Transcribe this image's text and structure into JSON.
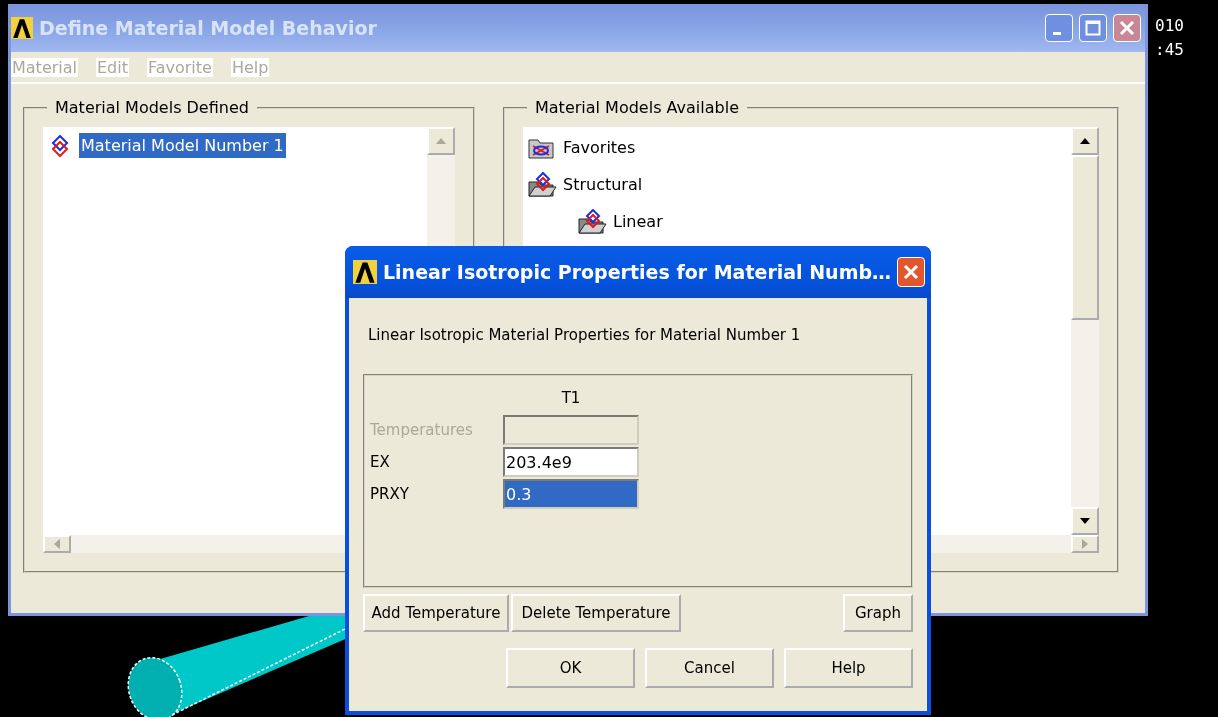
{
  "desktop": {
    "clock_lines": [
      "010",
      ":45"
    ]
  },
  "main_window": {
    "title": "Define Material Model Behavior",
    "active": false,
    "menu": [
      {
        "label": "Material",
        "disabled": true
      },
      {
        "label": "Edit",
        "disabled": true
      },
      {
        "label": "Favorite",
        "disabled": true
      },
      {
        "label": "Help",
        "disabled": true
      }
    ],
    "defined_panel": {
      "title": "Material Models Defined",
      "items": [
        {
          "label": "Material Model Number 1",
          "selected": true
        }
      ]
    },
    "available_panel": {
      "title": "Material Models Available",
      "tree": [
        {
          "label": "Favorites",
          "expanded": false
        },
        {
          "label": "Structural",
          "expanded": true,
          "children": [
            {
              "label": "Linear",
              "expanded": true
            }
          ]
        }
      ]
    }
  },
  "dialog": {
    "title": "Linear Isotropic Properties for Material Numb…",
    "heading": "Linear Isotropic Material Properties for Material Number 1",
    "column": "T1",
    "rows": [
      {
        "label": "Temperatures",
        "disabled": true,
        "selected": false
      },
      {
        "label": "EX",
        "value": "203.4e9",
        "disabled": false,
        "selected": false
      },
      {
        "label": "PRXY",
        "value": "0.3",
        "disabled": false,
        "selected": true
      }
    ],
    "table_buttons": [
      "Add Temperature",
      "Delete Temperature",
      "Graph"
    ],
    "buttons": [
      "OK",
      "Cancel",
      "Help"
    ]
  }
}
